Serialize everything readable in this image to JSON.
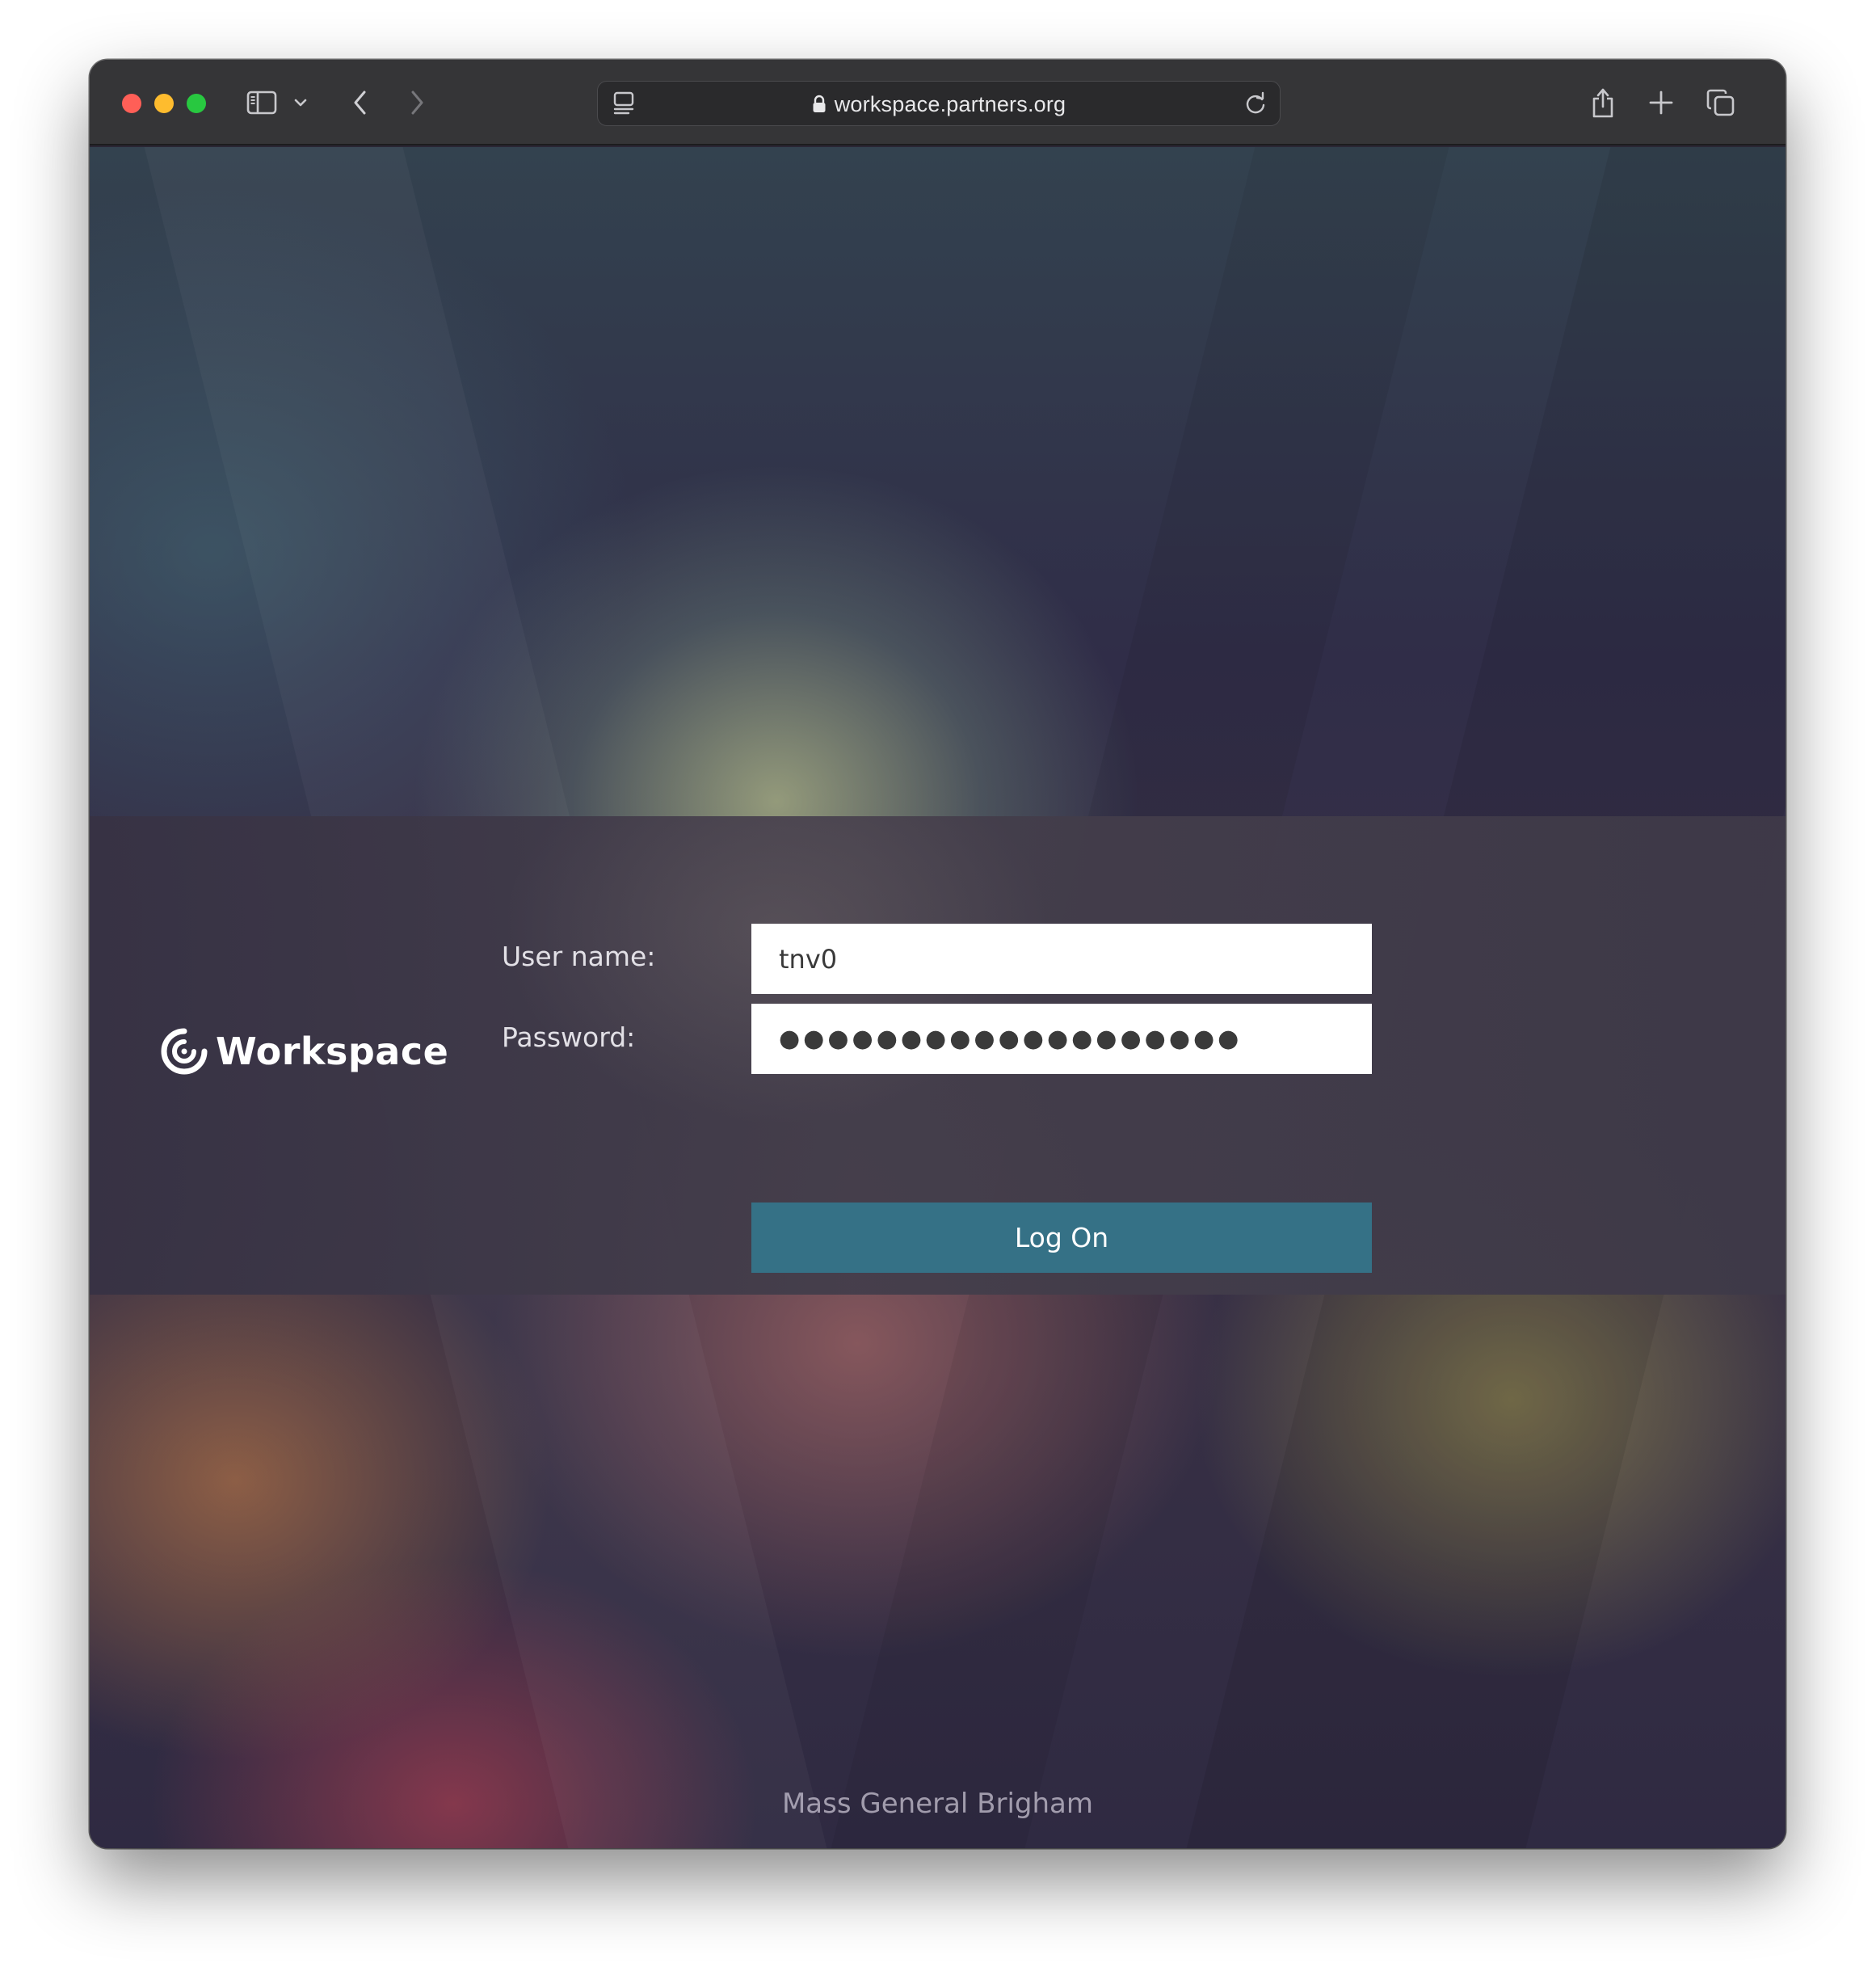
{
  "browser": {
    "url": "workspace.partners.org",
    "icons": {
      "close": "close-dot",
      "minimize": "minimize-dot",
      "zoom": "zoom-dot",
      "sidebar": "sidebar-icon",
      "sidebar_menu": "chevron-down-icon",
      "back": "chevron-left-icon",
      "forward": "chevron-right-icon",
      "page_menu": "page-menu-icon",
      "lock": "lock-icon",
      "reload": "reload-icon",
      "share": "share-icon",
      "new_tab": "plus-icon",
      "tab_overview": "tabs-icon"
    }
  },
  "page": {
    "logo_text": "Workspace",
    "form": {
      "username_label": "User name:",
      "username_value": "tnv0",
      "password_label": "Password:",
      "password_value": "●●●●●●●●●●●●●●●●●●●",
      "logon_label": "Log On"
    },
    "footer": "Mass General Brigham"
  },
  "colors": {
    "button": "#357186",
    "toolbar": "#353537",
    "close": "#ff5f57",
    "minimize": "#febc2e",
    "zoom": "#28c840"
  }
}
